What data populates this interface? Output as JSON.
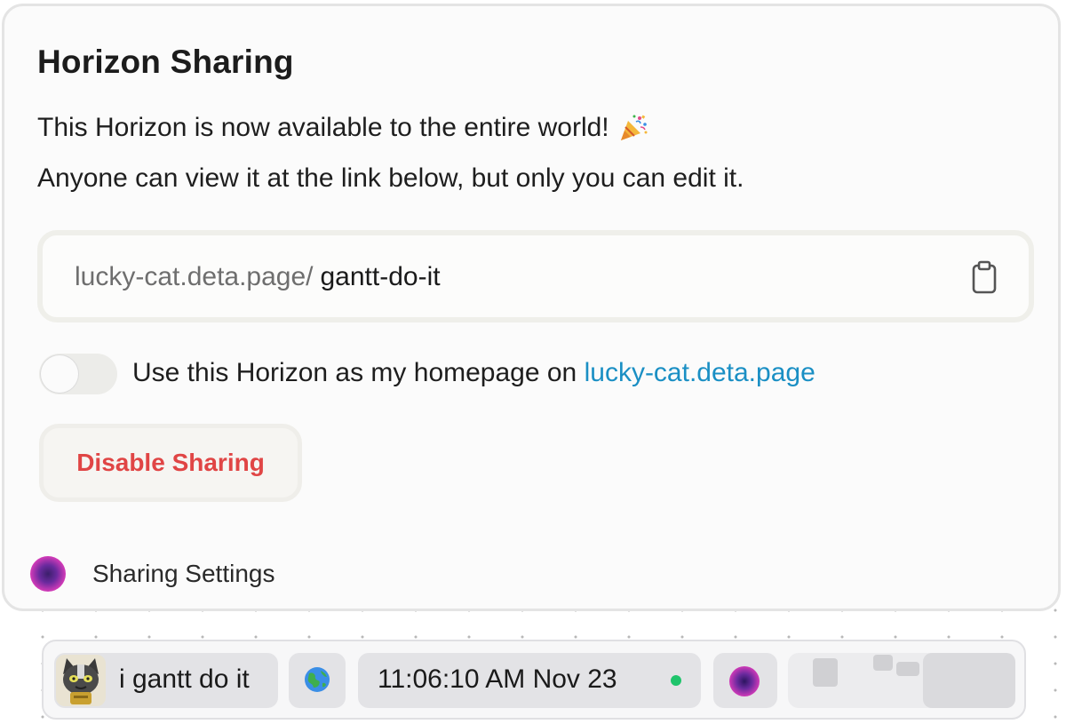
{
  "dialog": {
    "title": "Horizon Sharing",
    "message_line1": "This Horizon is now available to the entire world!",
    "message_line2": "Anyone can view it at the link below, but only you can edit it.",
    "url_prefix": "lucky-cat.deta.page/",
    "url_slug": "gantt-do-it",
    "homepage_toggle": {
      "label": "Use this Horizon as my homepage on",
      "link_text": "lucky-cat.deta.page",
      "enabled": false
    },
    "disable_button_label": "Disable Sharing",
    "footer_label": "Sharing Settings"
  },
  "taskbar": {
    "app_label": "i gantt do it",
    "clock_text": "11:06:10 AM Nov 23",
    "status_color": "#1fc46b"
  },
  "colors": {
    "danger": "#e04545",
    "link": "#1a8fc4",
    "accent_orb": "#d33bb8"
  },
  "icons": {
    "celebration": "party-popper-icon",
    "copy": "clipboard-icon",
    "globe": "globe-icon",
    "orb": "horizon-orb-icon",
    "avatar": "cat-avatar"
  }
}
